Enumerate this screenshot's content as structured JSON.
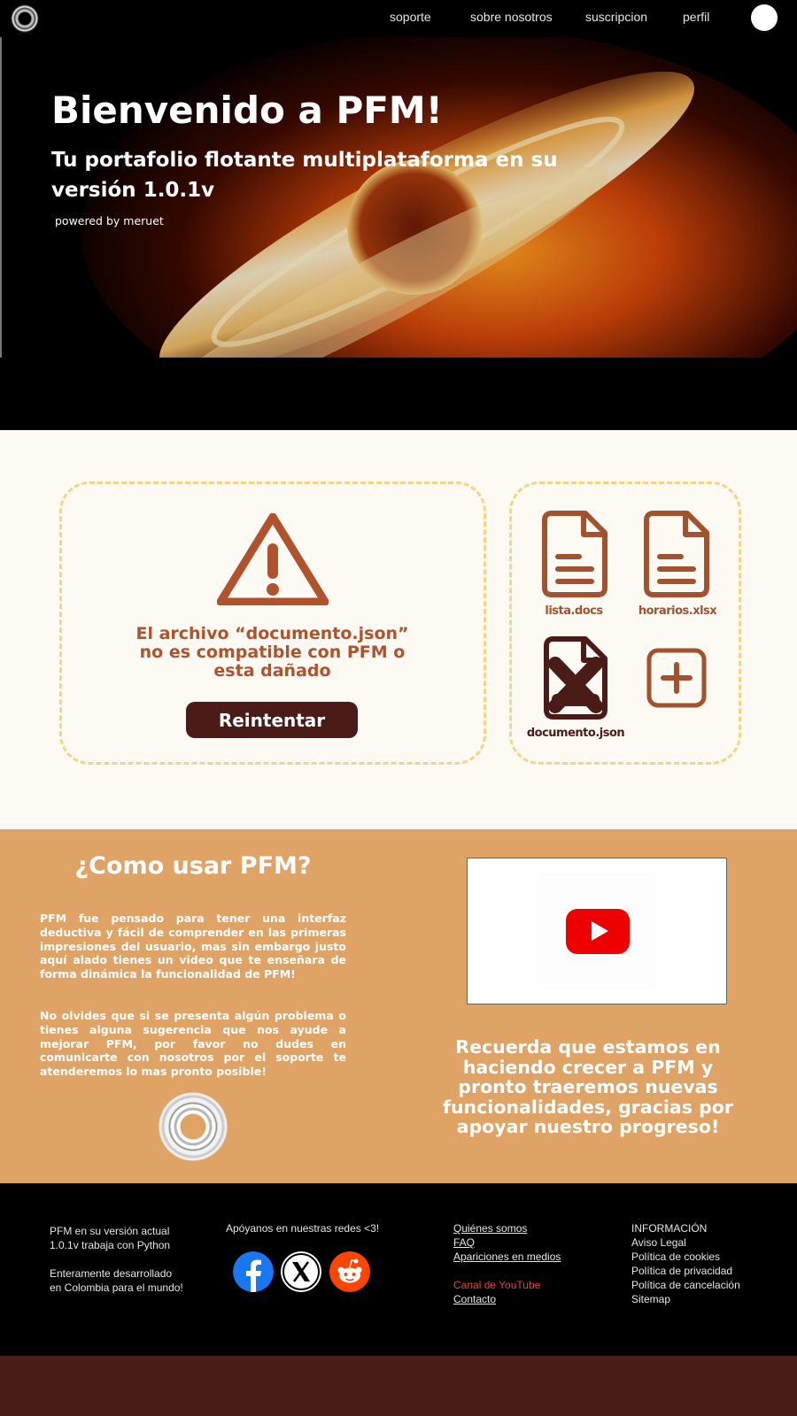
{
  "nav": {
    "links": [
      "soporte",
      "sobre nosotros",
      "suscripcion",
      "perfil"
    ]
  },
  "hero": {
    "title": "Bienvenido a PFM!",
    "subtitle": "Tu portafolio flotante multiplataforma en su versión 1.0.1v",
    "powered": "powered by meruet"
  },
  "error_card": {
    "message": "El archivo “documento.json” no es compatible con PFM o esta dañado",
    "retry_label": "Reintentar"
  },
  "files": [
    {
      "name": "lista.docs",
      "icon": "document-icon"
    },
    {
      "name": "horarios.xlsx",
      "icon": "document-icon"
    },
    {
      "name": "documento.json",
      "icon": "corrupted-file-icon"
    }
  ],
  "howto": {
    "title": "¿Como usar PFM?",
    "paragraph1": "PFM fue pensado para tener una interfaz deductiva y fácil de comprender en las primeras impresiones del usuario, mas sin embargo justo aquí alado tienes un video que te enseñara de forma dinámica la funcionalidad de PFM!",
    "paragraph2": "No olvides que si se presenta algún problema o tienes alguna sugerencia que nos ayude a mejorar PFM, por favor no dudes en comunicarte con nosotros por el soporte te atenderemos lo mas pronto posible!",
    "reminder": "Recuerda que estamos en haciendo crecer a PFM y pronto traeremos nuevas funcionalidades, gracias por apoyar nuestro progreso!"
  },
  "footer": {
    "about_line1": "PFM en su versión actual",
    "about_line2": "1.0.1v trabaja con Python",
    "about_line3": "Enteramente desarrollado",
    "about_line4": "en Colombia para el mundo!",
    "social_title": "Apóyanos en nuestras redes <3!",
    "links": [
      "Quiénes somos",
      "FAQ",
      "Apariciones en medios",
      "Canal de YouTube",
      "Contacto"
    ],
    "info": [
      "INFORMACIÓN",
      "Aviso Legal",
      "Política de cookies",
      "Política de privacidad",
      "Política de cancelación",
      "Sitemap"
    ]
  },
  "colors": {
    "accent_brown": "#b0532c",
    "dark_maroon": "#4a1b17",
    "orange_section": "#e0a366",
    "dashed_border": "#f3d583",
    "cream": "#fdf9f3"
  }
}
